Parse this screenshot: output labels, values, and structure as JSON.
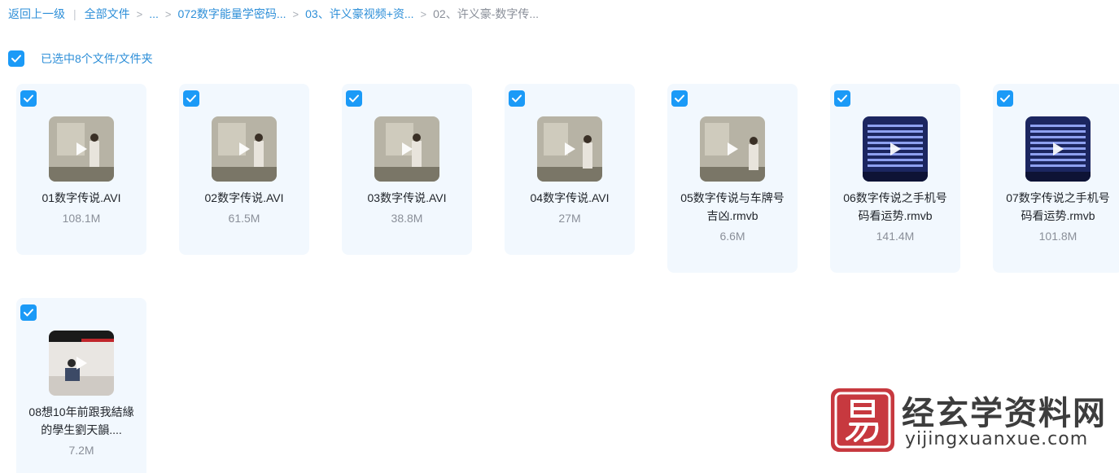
{
  "breadcrumb": {
    "back": "返回上一级",
    "separator": "|",
    "items": [
      "全部文件",
      "...",
      "072数字能量学密码...",
      "03、许义豪视频+资...",
      "02、许义豪-数字传..."
    ]
  },
  "selection": {
    "label": "已选中8个文件/文件夹",
    "checked": true
  },
  "files": [
    {
      "name": "01数字传说.AVI",
      "size": "108.1M",
      "thumb": "classroom-icon"
    },
    {
      "name": "02数字传说.AVI",
      "size": "61.5M",
      "thumb": "classroom-icon"
    },
    {
      "name": "03数字传说.AVI",
      "size": "38.8M",
      "thumb": "classroom-icon"
    },
    {
      "name": "04数字传说.AVI",
      "size": "27M",
      "thumb": "classroom-icon"
    },
    {
      "name": "05数字传说与车牌号吉凶.rmvb",
      "size": "6.6M",
      "thumb": "classroom-icon"
    },
    {
      "name": "06数字传说之手机号码看运势.rmvb",
      "size": "141.4M",
      "thumb": "number-grid-icon"
    },
    {
      "name": "07数字传说之手机号码看运势.rmvb",
      "size": "101.8M",
      "thumb": "number-grid-icon"
    },
    {
      "name": "08想10年前跟我結緣的學生劉天韻....",
      "size": "7.2M",
      "thumb": "lecture-hall-icon"
    }
  ],
  "watermark": {
    "logo_icon": "yi-seal-icon",
    "title": "经玄学资料网",
    "url": "yijingxuanxue.com"
  },
  "colors": {
    "accent": "#1b9af7",
    "link": "#2e8fd8",
    "card_bg": "#f2f8fe",
    "seal": "#c7393f"
  }
}
